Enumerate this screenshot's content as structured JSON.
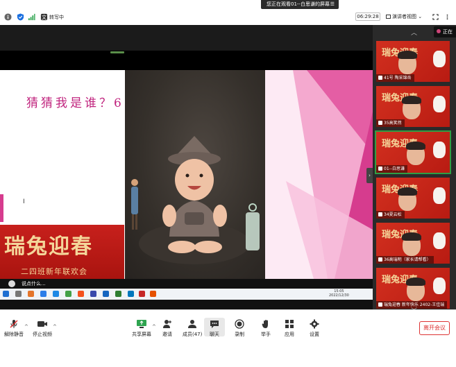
{
  "banner": {
    "text": "您正在观看01--白思谦的屏幕"
  },
  "topbar": {
    "status_text": "转写中",
    "time": "06:29:28",
    "view_label": "演讲者视图"
  },
  "slide": {
    "title": "猜猜我是谁？6",
    "festival_title": "瑞兔迎春",
    "festival_subtitle": "二四班新年联欢会"
  },
  "chat": {
    "placeholder_text": "说点什么..."
  },
  "taskbar": {
    "time": "15:05",
    "date": "2022/12/30"
  },
  "gallery": {
    "partial_label": "正在",
    "tiles": [
      {
        "label": "41号 陶采锦岳",
        "active": false
      },
      {
        "label": "35高笑然",
        "active": false
      },
      {
        "label": "01--白思谦",
        "active": true
      },
      {
        "label": "34夏云松",
        "active": false
      },
      {
        "label": "36高瑞明（家长请帮看）",
        "active": false
      },
      {
        "label": "瑞兔迎春 新年快乐 2402-王佳瑞",
        "active": false
      }
    ]
  },
  "toolbar": {
    "unmute": "解除静音",
    "stop_video": "停止视频",
    "share_screen": "共享屏幕",
    "invite": "邀请",
    "members": "成员(47)",
    "chat": "聊天",
    "record": "录制",
    "raise_hand": "举手",
    "apps": "应用",
    "settings": "设置",
    "leave": "离开会议"
  }
}
